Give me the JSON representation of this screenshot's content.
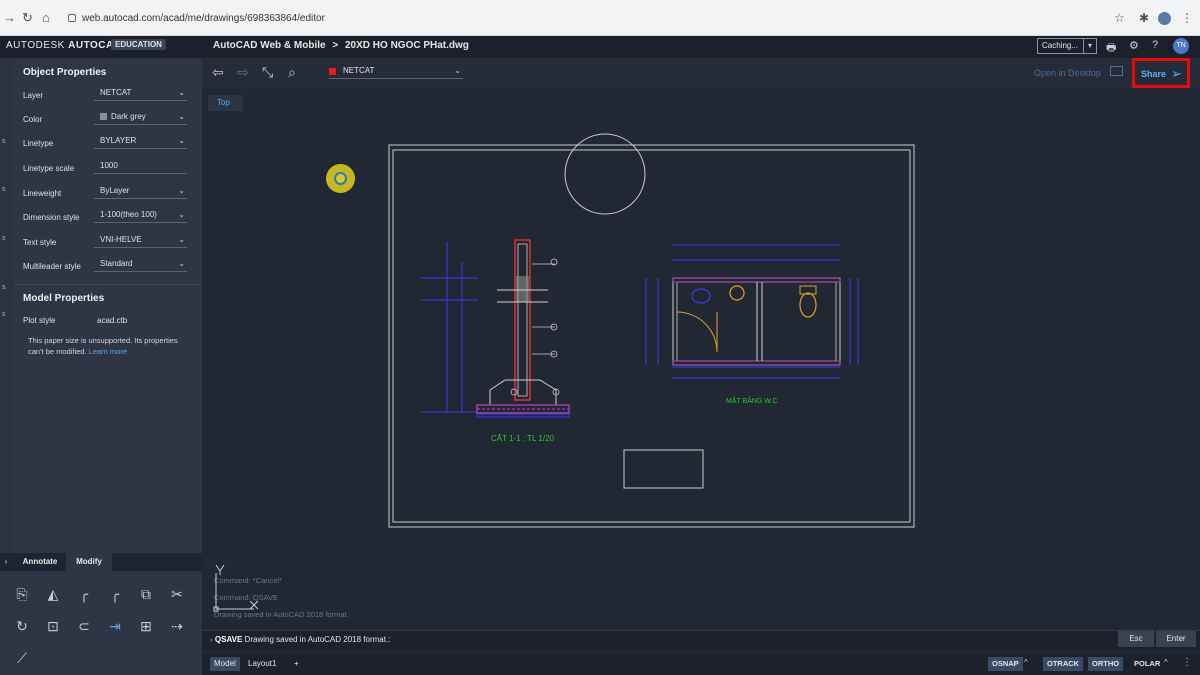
{
  "browser": {
    "url": "web.autocad.com/acad/me/drawings/698363864/editor"
  },
  "header": {
    "brand_light": "AUTODESK",
    "brand_bold": "AUTOCAD",
    "edition_badge": "EDUCATION",
    "app_name": "AutoCAD Web & Mobile",
    "separator": ">",
    "file_name": "20XD HO NGOC PHat.dwg",
    "caching_label": "Caching...",
    "user_initials": "TN"
  },
  "left_strip": [
    "s",
    "s",
    "s",
    "s",
    "s"
  ],
  "object_properties": {
    "title": "Object Properties",
    "rows": [
      {
        "label": "Layer",
        "value": "NETCAT",
        "dropdown": true
      },
      {
        "label": "Color",
        "value": "Dark grey",
        "dropdown": true,
        "swatch": "#8b8f96"
      },
      {
        "label": "Linetype",
        "value": "BYLAYER",
        "dropdown": true
      },
      {
        "label": "Linetype scale",
        "value": "1000",
        "dropdown": false
      },
      {
        "label": "Lineweight",
        "value": "ByLayer",
        "dropdown": true
      },
      {
        "label": "Dimension style",
        "value": "1-100(theo 100)",
        "dropdown": true
      },
      {
        "label": "Text style",
        "value": "VNI-HELVE",
        "dropdown": true
      },
      {
        "label": "Multileader style",
        "value": "Standard",
        "dropdown": true
      }
    ]
  },
  "model_properties": {
    "title": "Model Properties",
    "plot_style_label": "Plot style",
    "plot_style_value": "acad.ctb",
    "note": "This paper size is unsupported. Its properties can't be modified.",
    "learn_more": "Learn more"
  },
  "bottom_tabs": {
    "annotate": "Annotate",
    "modify": "Modify"
  },
  "modify_tools": [
    "stretch-icon",
    "mirror-icon",
    "fillet-icon",
    "chamfer-icon",
    "copy-icon",
    "trim-icon",
    "rotate-icon",
    "scale-icon",
    "offset-icon",
    "extend-icon",
    "array-icon",
    "move-icon",
    "explode-icon"
  ],
  "canvas_toolbar": {
    "current_layer": "NETCAT",
    "layer_color": "#e02020",
    "open_in_desktop": "Open in Desktop",
    "share": "Share"
  },
  "view": {
    "label": "Top"
  },
  "drawing": {
    "section_label": "CẮT 1-1 : TL 1/20",
    "plan_label": "MẶT BẰNG W.C"
  },
  "command_history": [
    "Command: *Cancel*",
    "Command: QSAVE",
    "Drawing saved in AutoCAD 2018 format."
  ],
  "command_line": {
    "command": "QSAVE",
    "message": "Drawing saved in AutoCAD 2018 format.:",
    "esc": "Esc",
    "enter": "Enter"
  },
  "status_bar": {
    "tabs": [
      "Model",
      "Layout1"
    ],
    "add": "+",
    "toggles": [
      {
        "label": "OSNAP",
        "on": true
      },
      {
        "label": "OTRACK",
        "on": true
      },
      {
        "label": "ORTHO",
        "on": true
      },
      {
        "label": "POLAR",
        "on": false
      }
    ]
  },
  "colors": {
    "accent": "#5ab0ff",
    "highlight_box": "#e60c0c",
    "dim_blue": "#3a3af0",
    "green_text": "#2ec82e",
    "hatch_magenta": "#c040c0"
  }
}
